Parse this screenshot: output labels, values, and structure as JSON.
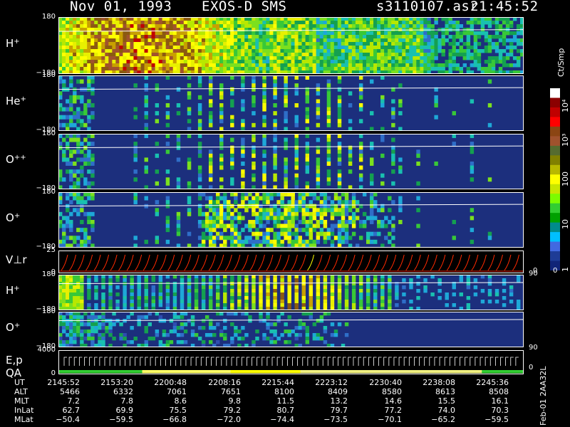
{
  "header": {
    "date": "Nov 01, 1993",
    "instrument": "EXOS-D SMS",
    "file": "s3110107.asr",
    "time": "21:45:52"
  },
  "panels": [
    {
      "label": "H",
      "sup": "+",
      "top_tick": "180",
      "bottom_tick": "−180"
    },
    {
      "label": "He",
      "sup": "+",
      "top_tick": "180",
      "bottom_tick": "−180"
    },
    {
      "label": "O",
      "sup": "++",
      "top_tick": "180",
      "bottom_tick": "−180"
    },
    {
      "label": "O",
      "sup": "+",
      "top_tick": "180",
      "bottom_tick": "−180"
    },
    {
      "label": "V⊥r",
      "sup": "",
      "top_tick": "25",
      "bottom_tick": "0",
      "right_tick": "90",
      "right_tick2": "0"
    },
    {
      "label": "H",
      "sup": "+",
      "top_tick": "180",
      "bottom_tick": "−180"
    },
    {
      "label": "O",
      "sup": "+",
      "top_tick": "180",
      "bottom_tick": "−180",
      "right_tick": "90"
    },
    {
      "label": "E,p",
      "label2": "QA",
      "sup": "",
      "top_tick": "4000",
      "bottom_tick": "0",
      "right_tick": "0"
    }
  ],
  "colorbar": {
    "unit": "Ct/Smp",
    "ticks": [
      "10⁴",
      "10³",
      "100",
      "10",
      "1",
      "0"
    ],
    "colors": [
      "#ffffff",
      "#8b0000",
      "#c00000",
      "#ff0000",
      "#8b4513",
      "#a0522d",
      "#556b2f",
      "#808000",
      "#b8b800",
      "#ffff00",
      "#c8e600",
      "#7cfc00",
      "#32cd32",
      "#00a000",
      "#008b8b",
      "#00bfff",
      "#4169e1",
      "#1e3c96",
      "#102478"
    ]
  },
  "footer": {
    "row_labels": [
      "UT",
      "ALT",
      "MLT",
      "InLat",
      "MLat"
    ],
    "columns": [
      [
        "2145:52",
        "5466",
        "7.2",
        "62.7",
        "−50.4"
      ],
      [
        "2153:20",
        "6332",
        "7.8",
        "69.9",
        "−59.5"
      ],
      [
        "2200:48",
        "7061",
        "8.6",
        "75.5",
        "−66.8"
      ],
      [
        "2208:16",
        "7651",
        "9.8",
        "79.2",
        "−72.0"
      ],
      [
        "2215:44",
        "8100",
        "11.5",
        "80.7",
        "−74.4"
      ],
      [
        "2223:12",
        "8409",
        "13.2",
        "79.7",
        "−73.5"
      ],
      [
        "2230:40",
        "8580",
        "14.6",
        "77.2",
        "−70.1"
      ],
      [
        "2238:08",
        "8613",
        "15.5",
        "74.0",
        "−65.2"
      ],
      [
        "2245:36",
        "8508",
        "16.1",
        "70.3",
        "−59.5"
      ]
    ],
    "side_note": "Feb-01 2AA32L"
  },
  "chart_data": {
    "type": "heatmap",
    "title": "Nov 01, 1993   EXOS-D SMS",
    "x_ticks_ut": [
      "2145:52",
      "2153:20",
      "2200:48",
      "2208:16",
      "2215:44",
      "2223:12",
      "2230:40",
      "2238:08",
      "2245:36"
    ],
    "y_range_pitch": [
      -180,
      180
    ],
    "vr_range": [
      0,
      25
    ],
    "ep_range": [
      0,
      4000
    ],
    "colorbar_unit": "Ct/Smp",
    "colorbar_range": [
      1,
      10000
    ],
    "panels": [
      "H+",
      "He+",
      "O++",
      "O+",
      "V⊥r",
      "H+",
      "O+",
      "E,p QA"
    ]
  }
}
